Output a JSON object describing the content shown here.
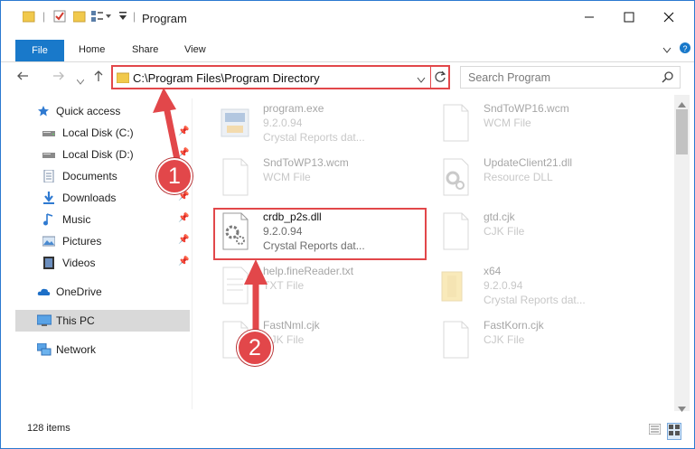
{
  "window": {
    "title": "Program",
    "accent": "#1979ca",
    "annotation_color": "#e2474a"
  },
  "ribbon": {
    "tabs": [
      {
        "label": "File"
      },
      {
        "label": "Home"
      },
      {
        "label": "Share"
      },
      {
        "label": "View"
      }
    ]
  },
  "address": {
    "path": "C:\\Program Files\\Program Directory"
  },
  "search": {
    "placeholder": "Search Program"
  },
  "sidebar": {
    "items": [
      {
        "label": "Quick access",
        "icon": "star-icon",
        "pinned": false
      },
      {
        "label": "Local Disk (C:)",
        "icon": "drive-icon",
        "pinned": true
      },
      {
        "label": "Local Disk (D:)",
        "icon": "drive-icon",
        "pinned": true
      },
      {
        "label": "Documents",
        "icon": "documents-icon",
        "pinned": true
      },
      {
        "label": "Downloads",
        "icon": "download-icon",
        "pinned": true
      },
      {
        "label": "Music",
        "icon": "music-icon",
        "pinned": true
      },
      {
        "label": "Pictures",
        "icon": "pictures-icon",
        "pinned": true
      },
      {
        "label": "Videos",
        "icon": "videos-icon",
        "pinned": true
      },
      {
        "label": "OneDrive",
        "icon": "cloud-icon",
        "pinned": false
      },
      {
        "label": "This PC",
        "icon": "computer-icon",
        "pinned": false,
        "selected": true
      },
      {
        "label": "Network",
        "icon": "network-icon",
        "pinned": false
      }
    ]
  },
  "files": [
    {
      "name": "program.exe",
      "line2": "9.2.0.94",
      "line3": "Crystal Reports dat..."
    },
    {
      "name": "SndToWP16.wcm",
      "line2": "WCM File",
      "line3": ""
    },
    {
      "name": "SndToWP13.wcm",
      "line2": "WCM File",
      "line3": ""
    },
    {
      "name": "UpdateClient21.dll",
      "line2": "Resource DLL",
      "line3": ""
    },
    {
      "name": "crdb_p2s.dll",
      "line2": "9.2.0.94",
      "line3": "Crystal Reports dat...",
      "highlighted": true
    },
    {
      "name": "gtd.cjk",
      "line2": "CJK File",
      "line3": ""
    },
    {
      "name": "help.fineReader.txt",
      "line2": "TXT File",
      "line3": ""
    },
    {
      "name": "x64",
      "line2": "9.2.0.94",
      "line3": "Crystal Reports dat..."
    },
    {
      "name": "FastNml.cjk",
      "line2": "CJK File",
      "line3": ""
    },
    {
      "name": "FastKorn.cjk",
      "line2": "CJK File",
      "line3": ""
    }
  ],
  "status": {
    "count": "128 items"
  },
  "annotations": {
    "step1": "1",
    "step2": "2"
  }
}
